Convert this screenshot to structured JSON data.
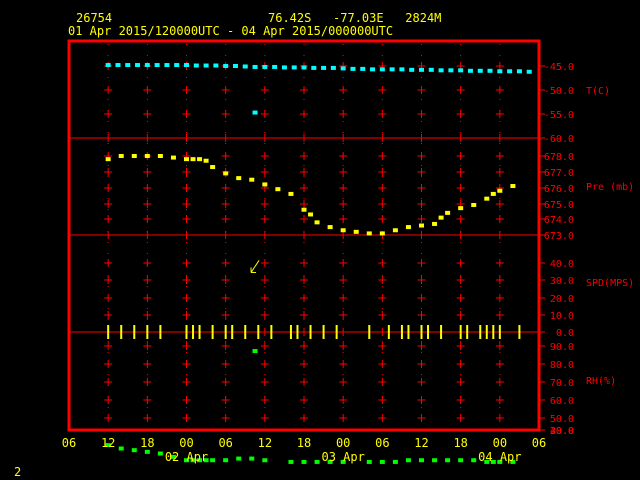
{
  "header": {
    "station": "26754",
    "location": "76.42S   -77.03E   2824M",
    "period": "01 Apr 2015/120000UTC - 04 Apr 2015/000000UTC"
  },
  "footer": {
    "page": "2"
  },
  "colors": {
    "background": "#000000",
    "frame": "#ff0000",
    "header_text": "#ffff00",
    "temperature": "#00ffff",
    "pressure": "#ffff00",
    "wind": "#ffff00",
    "humidity": "#00ff00",
    "axis_labels": "#ff0000",
    "time_labels": "#ffff00"
  },
  "chart_data": [
    {
      "type": "scatter",
      "name": "temperature",
      "ylabel": "T(C)",
      "yticks": [
        "-45.0",
        "-50.0",
        "-55.0",
        "-60.0"
      ],
      "ylim": [
        -60,
        -42
      ],
      "x_hours": [
        12,
        13.5,
        15,
        16.5,
        18,
        19.5,
        21,
        22.5,
        24,
        25.5,
        27,
        28.5,
        30,
        31.5,
        33,
        34.5,
        36,
        37.5,
        39,
        40.5,
        42,
        43.5,
        45,
        46.5,
        48,
        49.5,
        51,
        52.5,
        54,
        55.5,
        57,
        58.5,
        60,
        61.5,
        63,
        64.5,
        66,
        67.5,
        69,
        70.5,
        72,
        73.5,
        75,
        76.5
      ],
      "values": [
        -44.8,
        -44.8,
        -44.8,
        -44.8,
        -44.8,
        -44.8,
        -44.8,
        -44.8,
        -44.8,
        -44.9,
        -44.9,
        -44.9,
        -45.0,
        -45.0,
        -45.1,
        -45.2,
        -45.2,
        -45.2,
        -45.3,
        -45.3,
        -45.3,
        -45.4,
        -45.4,
        -45.4,
        -45.5,
        -45.6,
        -45.6,
        -45.7,
        -45.7,
        -45.7,
        -45.7,
        -45.8,
        -45.8,
        -45.8,
        -45.9,
        -45.9,
        -45.9,
        -46.0,
        -46.0,
        -46.0,
        -46.1,
        -46.1,
        -46.1,
        -46.2
      ],
      "outliers": [
        {
          "x_hour": 34.5,
          "value": -54.7
        }
      ]
    },
    {
      "type": "scatter",
      "name": "pressure",
      "ylabel": "Pre (mb)",
      "yticks": [
        "678.0",
        "677.0",
        "676.0",
        "675.0",
        "674.0",
        "673.0"
      ],
      "ylim": [
        672.9,
        678.3
      ],
      "x_hours": [
        12,
        14,
        16,
        18,
        20,
        22,
        24,
        25,
        26,
        27,
        28,
        30,
        32,
        34,
        36,
        38,
        40,
        42,
        43,
        44,
        46,
        48,
        50,
        52,
        54,
        56,
        58,
        60,
        62,
        63,
        64,
        66,
        68,
        70,
        71,
        72,
        74
      ],
      "values": [
        677.8,
        678.0,
        678.0,
        678.0,
        678.0,
        677.9,
        677.8,
        677.8,
        677.8,
        677.7,
        677.3,
        676.9,
        676.6,
        676.5,
        676.2,
        675.9,
        675.6,
        674.6,
        674.3,
        673.8,
        673.5,
        673.3,
        673.2,
        673.1,
        673.1,
        673.3,
        673.5,
        673.6,
        673.7,
        674.1,
        674.4,
        674.7,
        674.9,
        675.3,
        675.6,
        675.8,
        676.1
      ]
    },
    {
      "type": "scatter",
      "name": "wind",
      "ylabel": "SPD(MPS)",
      "yticks": [
        "40.0",
        "30.0",
        "20.0",
        "10.0",
        "0.0"
      ],
      "ylim": [
        0,
        46
      ],
      "barb": {
        "x_hour": 34.5,
        "value": 38.0
      },
      "calm_x_hours": [
        12,
        14,
        16,
        18,
        20,
        24,
        25,
        26,
        28,
        30,
        31,
        33,
        35,
        37,
        40,
        41,
        43,
        45,
        47,
        52,
        55,
        57,
        58,
        60,
        61,
        63,
        66,
        67,
        69,
        70,
        71,
        72,
        75
      ]
    },
    {
      "type": "scatter",
      "name": "humidity",
      "ylabel": "RH(%)",
      "yticks": [
        "90.0",
        "80.0",
        "70.0",
        "60.0",
        "50.0",
        "40.0",
        "30.0",
        "20.0"
      ],
      "ylim": [
        19,
        96
      ],
      "x_hours": [
        12,
        14,
        16,
        18,
        20,
        22,
        24,
        25,
        26,
        27,
        28,
        30,
        32,
        34,
        36,
        40,
        42,
        44,
        46,
        48,
        52,
        54,
        56,
        58,
        60,
        62,
        64,
        66,
        68,
        70,
        71,
        72,
        74
      ],
      "values": [
        31,
        29,
        28,
        27,
        26,
        24,
        22,
        22,
        22,
        22,
        22,
        22,
        23,
        23,
        22,
        21,
        21,
        21,
        21,
        21,
        21,
        21,
        21,
        22,
        22,
        22,
        22,
        22,
        22,
        21,
        21,
        21,
        21
      ],
      "outliers": [
        {
          "x_hour": 34.5,
          "value": 87
        }
      ]
    }
  ],
  "time_axis": {
    "x_range_hours": [
      6,
      78
    ],
    "tick_labels": [
      "06",
      "12",
      "18",
      "00",
      "06",
      "12",
      "18",
      "00",
      "06",
      "12",
      "18",
      "00",
      "06"
    ],
    "day_labels": [
      "02 Apr",
      "03 Apr",
      "04 Apr"
    ]
  }
}
